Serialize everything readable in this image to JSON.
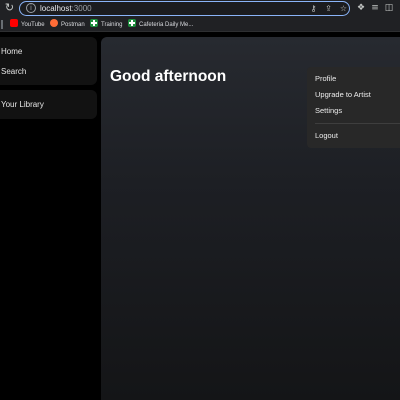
{
  "browser": {
    "url_host": "localhost",
    "url_port": ":3000",
    "icons": {
      "reload": "reload-icon",
      "site_info": "site-info-icon",
      "password": "key-icon",
      "share": "share-icon",
      "bookmark": "star-icon",
      "extensions": "puzzle-icon",
      "reading_list": "reading-list-icon",
      "side_panel": "side-panel-icon",
      "menu": "more-icon"
    }
  },
  "bookmarks": [
    {
      "label": "YouTube",
      "icon": "youtube-icon",
      "color": "#ff0000"
    },
    {
      "label": "Postman",
      "icon": "postman-icon",
      "color": "#ff6c37"
    },
    {
      "label": "Training",
      "icon": "sheets-icon",
      "color": "#1e8e3e"
    },
    {
      "label": "Cafeteria Daily Me...",
      "icon": "sheets-icon",
      "color": "#1e8e3e"
    }
  ],
  "sidebar": {
    "items": [
      {
        "label": "Home"
      },
      {
        "label": "Search"
      }
    ],
    "library_label": "Your Library"
  },
  "main": {
    "greeting": "Good afternoon"
  },
  "user_menu": {
    "items": [
      {
        "label": "Profile"
      },
      {
        "label": "Upgrade to Artist"
      },
      {
        "label": "Settings"
      }
    ],
    "logout_label": "Logout"
  },
  "colors": {
    "focus_ring": "#8ab4f8",
    "app_background": "#000000",
    "panel": "#121212",
    "menu_background": "#282828"
  }
}
